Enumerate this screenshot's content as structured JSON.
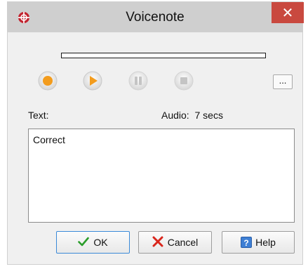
{
  "window": {
    "title": "Voicenote",
    "close_glyph": "✕"
  },
  "recorder": {
    "progress": 0,
    "controls": [
      {
        "name": "record",
        "icon": "record-icon",
        "enabled": true
      },
      {
        "name": "play",
        "icon": "play-icon",
        "enabled": true
      },
      {
        "name": "pause",
        "icon": "pause-icon",
        "enabled": false
      },
      {
        "name": "stop",
        "icon": "stop-icon",
        "enabled": false
      }
    ],
    "more_label": "..."
  },
  "labels": {
    "text": "Text:",
    "audio": "Audio:  7 secs"
  },
  "textbox": {
    "value": "Correct"
  },
  "buttons": {
    "ok": "OK",
    "cancel": "Cancel",
    "help": "Help"
  },
  "colors": {
    "accent": "#f39c1d",
    "close": "#c9493f",
    "ok_check": "#2a9d2a",
    "cancel_x": "#d9261c"
  }
}
